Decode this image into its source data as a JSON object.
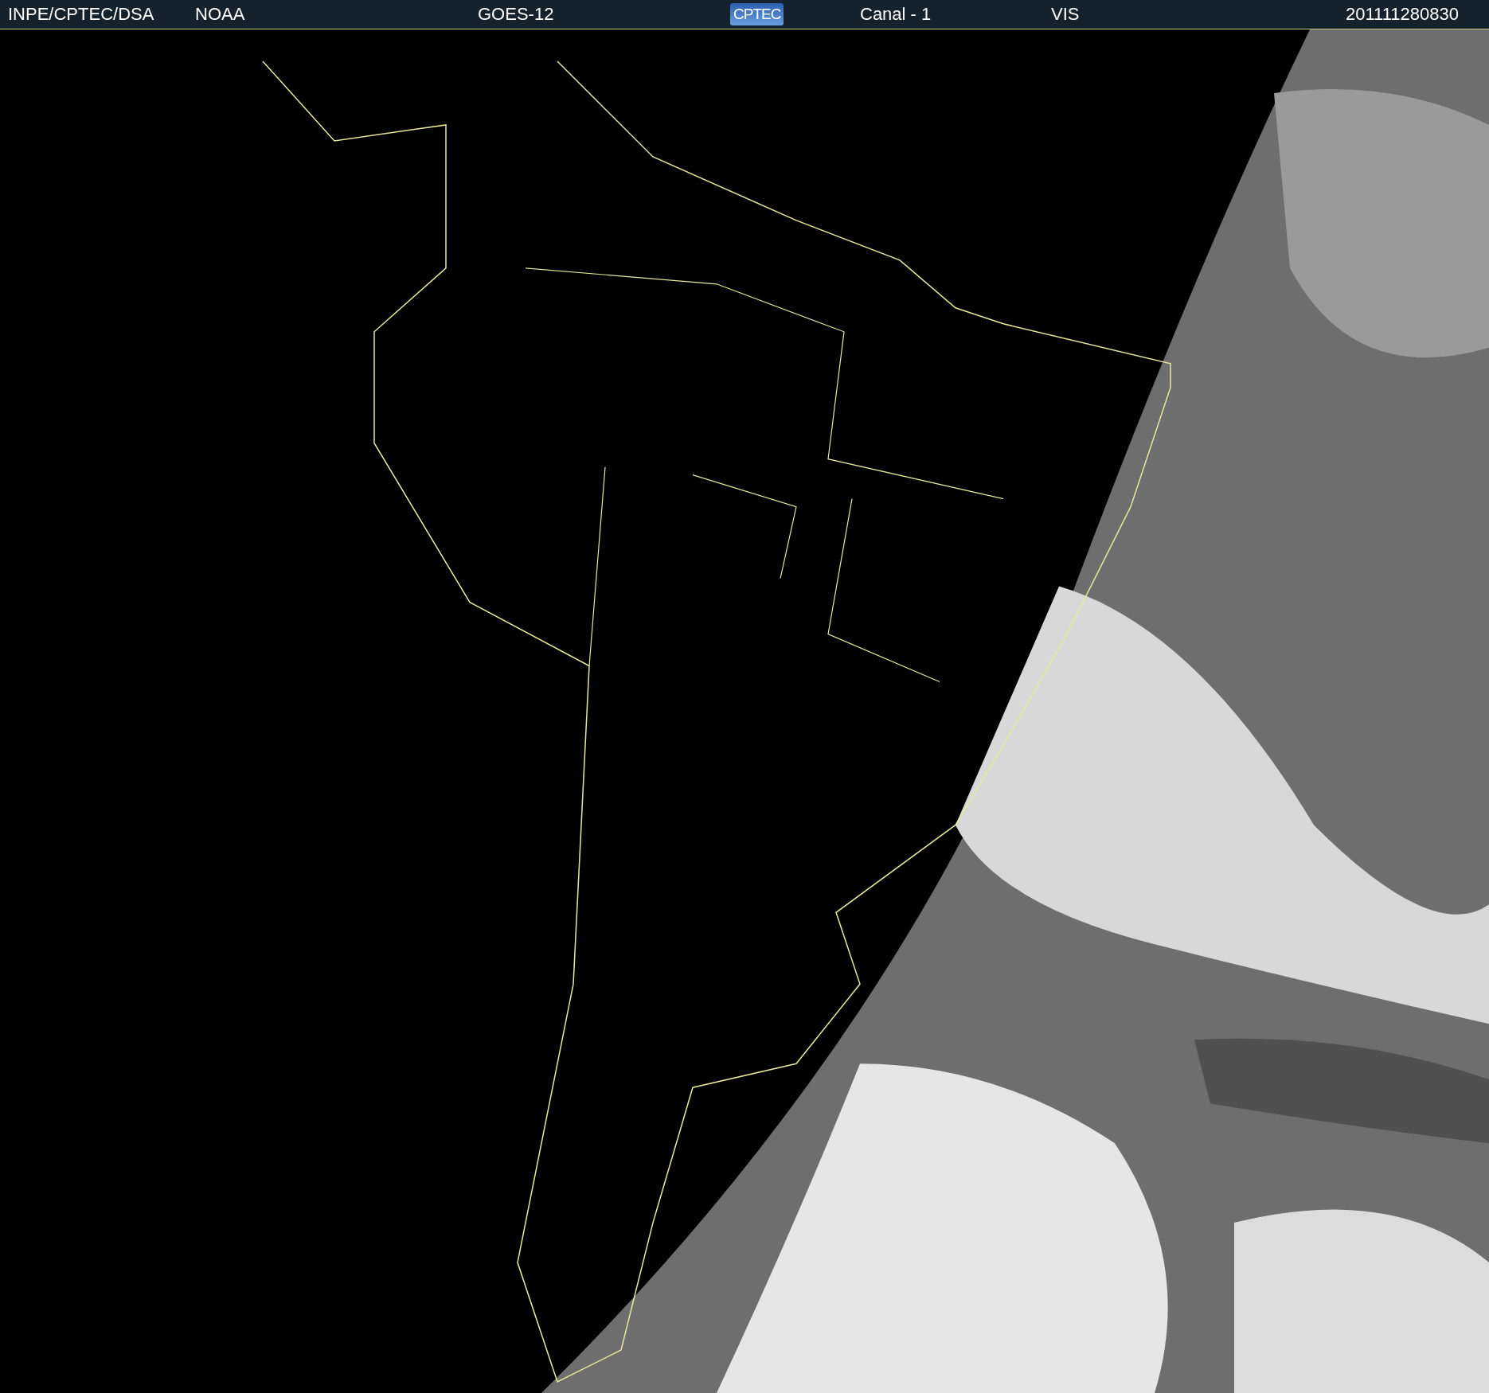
{
  "header": {
    "items": [
      {
        "kind": "text",
        "text": "INPE/CPTEC/DSA"
      },
      {
        "kind": "text",
        "text": "NOAA"
      },
      {
        "kind": "text",
        "text": "GOES-12"
      },
      {
        "kind": "logo",
        "text": "CPTEC"
      },
      {
        "kind": "text",
        "text": "Canal - 1"
      },
      {
        "kind": "text",
        "text": "VIS"
      },
      {
        "kind": "text",
        "text": "201111280830"
      }
    ]
  }
}
